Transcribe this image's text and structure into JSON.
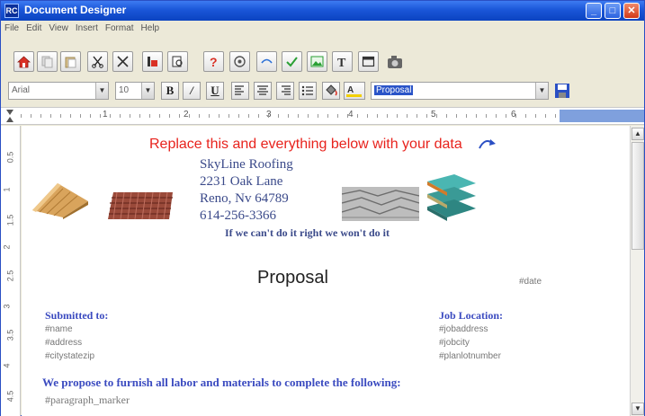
{
  "window": {
    "title": "Document Designer",
    "app_icon": "RC"
  },
  "menu": [
    "File",
    "Edit",
    "View",
    "Insert",
    "Format",
    "Help"
  ],
  "toolbar": {
    "icons": [
      "home-icon",
      "copy-icon",
      "paste-icon",
      "cut-icon",
      "delete-icon",
      "insert-field-icon",
      "find-icon",
      "help-icon",
      "print-icon",
      "link-icon",
      "check-icon",
      "image-icon",
      "text-icon",
      "frame-icon",
      "camera-icon"
    ]
  },
  "format": {
    "font": "Arial",
    "size": "10",
    "bold": "B",
    "italic": "/",
    "underline": "U",
    "style_value": "Proposal"
  },
  "ruler": {
    "numbers": [
      "1",
      "2",
      "3",
      "4",
      "5",
      "6"
    ]
  },
  "left_ruler": [
    "0.5",
    "1",
    "1.5",
    "2",
    "2.5",
    "3",
    "3.5",
    "4",
    "4.5"
  ],
  "document": {
    "replace_note": "Replace this and everything below with your data",
    "company": {
      "name": "SkyLine Roofing",
      "street": "2231 Oak Lane",
      "city": "Reno, Nv 64789",
      "phone": "614-256-3366"
    },
    "slogan": "If we can't do it right we won't do it",
    "title": "Proposal",
    "date_field": "#date",
    "submitted_to": {
      "heading": "Submitted to:",
      "fields": [
        "#name",
        "#address",
        "#citystatezip"
      ]
    },
    "job_location": {
      "heading": "Job Location:",
      "fields": [
        "#jobaddress",
        "#jobcity",
        "#planlotnumber"
      ]
    },
    "propose_text": "We propose to furnish all labor and materials to complete the following:",
    "paragraph_marker": "#paragraph_marker"
  },
  "colors": {
    "title_bar": "#1a56d8",
    "replace_text": "#e8231d",
    "heading_blue": "#3b4bc0",
    "company_text": "#3b4a8a"
  }
}
